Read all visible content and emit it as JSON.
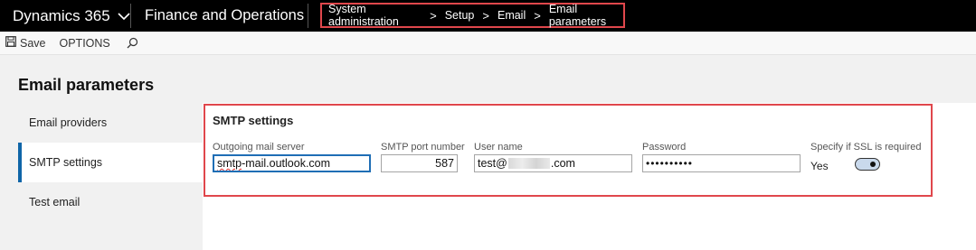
{
  "header": {
    "brand": "Dynamics 365",
    "app_name": "Finance and Operations",
    "breadcrumb": [
      "System administration",
      "Setup",
      "Email",
      "Email parameters"
    ]
  },
  "actions": {
    "save_label": "Save",
    "options_label": "OPTIONS"
  },
  "page": {
    "title": "Email parameters"
  },
  "sidenav": {
    "items": [
      {
        "label": "Email providers",
        "active": false
      },
      {
        "label": "SMTP settings",
        "active": true
      },
      {
        "label": "Test email",
        "active": false
      }
    ]
  },
  "smtp": {
    "section_title": "SMTP settings",
    "server": {
      "label": "Outgoing mail server",
      "value": "smtp-mail.outlook.com",
      "misspelled": "smtp",
      "rest": "-mail.outlook.com"
    },
    "port": {
      "label": "SMTP port number",
      "value": "587"
    },
    "user": {
      "label": "User name",
      "prefix": "test@",
      "suffix": ".com"
    },
    "password": {
      "label": "Password",
      "value": "••••••••••"
    },
    "ssl": {
      "label": "Specify if SSL is required",
      "value": "Yes",
      "enabled": true
    }
  },
  "colors": {
    "accent": "#0f65a8",
    "highlight_border": "#e0474c",
    "nav_bar": "#000000"
  }
}
